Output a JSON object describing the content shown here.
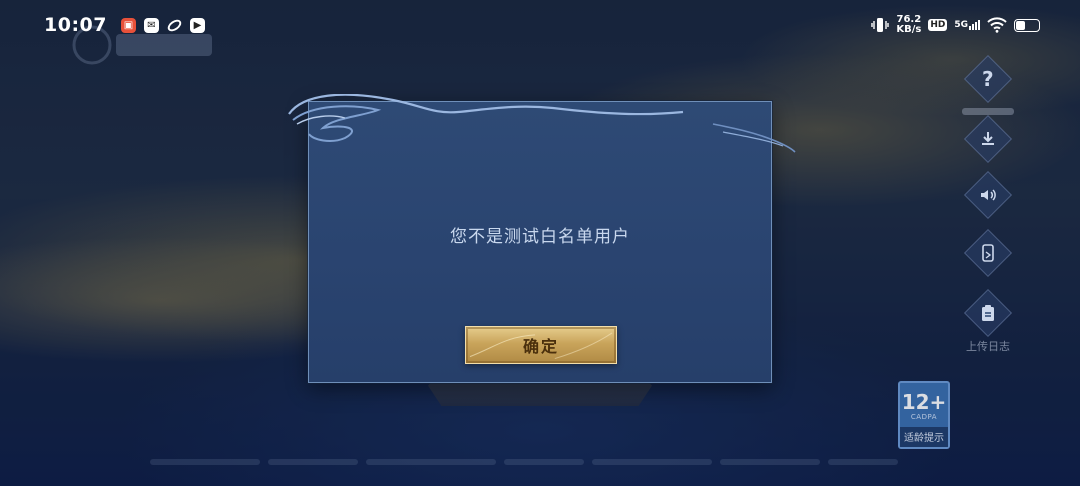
{
  "status_bar": {
    "time": "10:07",
    "net_speed_value": "76.2",
    "net_speed_unit": "KB/s",
    "hd_label": "HD",
    "network_label": "5G",
    "icons": [
      "app-notification-icon",
      "mail-icon",
      "link-icon",
      "video-app-icon",
      "vibrate-icon",
      "wifi-icon",
      "battery-icon"
    ]
  },
  "side_menu": {
    "items": [
      {
        "name": "help",
        "icon": "question-icon",
        "label": ""
      },
      {
        "name": "repair",
        "icon": "download-icon",
        "label": ""
      },
      {
        "name": "sound",
        "icon": "speaker-icon",
        "label": ""
      },
      {
        "name": "device",
        "icon": "phone-icon",
        "label": ""
      },
      {
        "name": "upload-log",
        "icon": "clipboard-icon",
        "label": "上传日志"
      }
    ]
  },
  "age_badge": {
    "rating": "12+",
    "org": "CADPA",
    "tip": "适龄提示"
  },
  "dialog": {
    "message": "您不是测试白名单用户",
    "confirm_label": "确定"
  },
  "colors": {
    "dialog_bg": "#2e4a75",
    "dialog_border": "#6f8fb9",
    "button_gold": "#c9a45b",
    "message_text": "#c9d8ee"
  }
}
